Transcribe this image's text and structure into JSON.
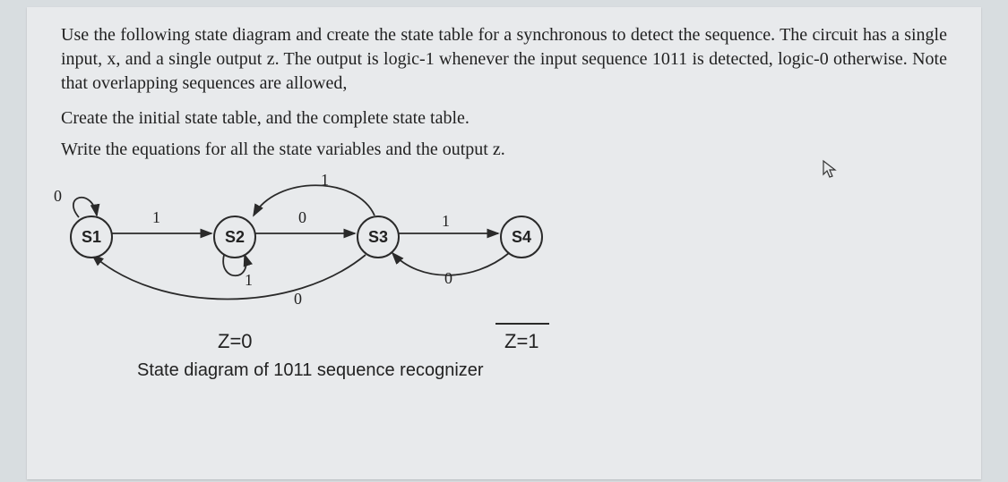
{
  "text": {
    "para1": "Use the following state diagram and create the state table for a synchronous to detect the sequence. The circuit has a single input, x, and a single output z.  The output is logic-1 whenever the input sequence 1011 is detected, logic-0 otherwise.  Note that overlapping sequences are allowed,",
    "para2": "Create the initial state table, and the complete state table.",
    "para3": "Write the equations for all the state variables and the output z."
  },
  "diagram": {
    "states": {
      "s1": "S1",
      "s2": "S2",
      "s3": "S3",
      "s4": "S4"
    },
    "edges": {
      "s1_self_0": "0",
      "s1_s2_1": "1",
      "s2_s3_0": "0",
      "s2_self_1": "1",
      "s3_s2_1_top": "1",
      "s3_s4_1": "1",
      "s3_s1_0": "0",
      "s4_s3_0": "0"
    },
    "outputs": {
      "z0": "Z=0",
      "z1": "Z=1"
    },
    "caption": "State diagram of 1011 sequence recognizer"
  }
}
